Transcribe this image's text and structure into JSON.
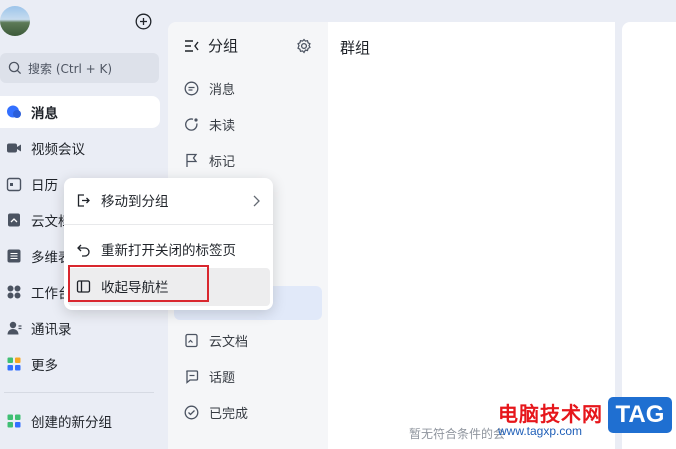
{
  "colors": {
    "accent": "#3370ff",
    "highlight_box": "#d9272e",
    "watermark_red": "#e6161b",
    "watermark_blue": "#1f6fd1"
  },
  "search": {
    "placeholder": "搜索 (Ctrl + K)"
  },
  "nav": {
    "items": [
      {
        "label": "消息",
        "icon": "message-icon",
        "active": true
      },
      {
        "label": "视频会议",
        "icon": "video-camera-icon"
      },
      {
        "label": "日历",
        "icon": "calendar-icon"
      },
      {
        "label": "云文档",
        "icon": "cloud-doc-icon"
      },
      {
        "label": "多维表格",
        "icon": "table-icon"
      },
      {
        "label": "工作台",
        "icon": "workspace-icon"
      },
      {
        "label": "通讯录",
        "icon": "contacts-icon"
      },
      {
        "label": "更多",
        "icon": "more-apps-icon"
      }
    ],
    "custom_group": {
      "label": "创建的新分组",
      "icon": "new-group-icon"
    }
  },
  "groups_panel": {
    "title": "分组",
    "items": [
      {
        "label": "消息",
        "icon": "chat-bubble-icon"
      },
      {
        "label": "未读",
        "icon": "unread-icon"
      },
      {
        "label": "标记",
        "icon": "flag-icon"
      },
      {
        "label": "云文档",
        "icon": "document-icon"
      },
      {
        "label": "话题",
        "icon": "topic-icon"
      },
      {
        "label": "已完成",
        "icon": "check-circle-icon"
      }
    ]
  },
  "main": {
    "title": "群组",
    "empty_text": "暂无符合条件的会话"
  },
  "context_menu": {
    "items": [
      {
        "label": "移动到分组",
        "icon": "move-to-group-icon",
        "has_submenu": true
      },
      {
        "label": "重新打开关闭的标签页",
        "icon": "reopen-icon"
      },
      {
        "label": "收起导航栏",
        "icon": "collapse-sidebar-icon",
        "highlighted": true
      }
    ]
  },
  "watermark": {
    "text": "电脑技术网",
    "url": "www.tagxp.com",
    "logo": "TAG"
  }
}
